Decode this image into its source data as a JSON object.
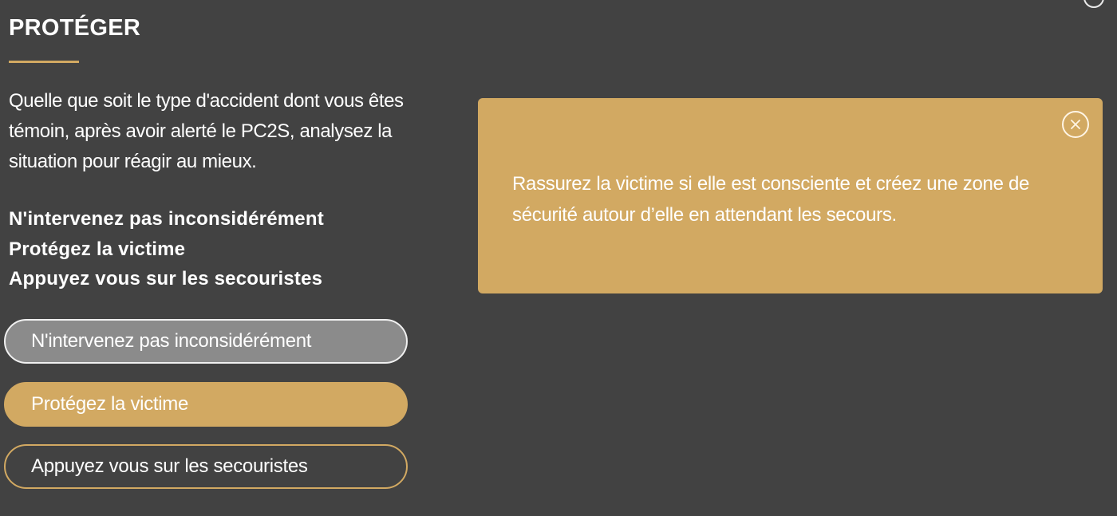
{
  "page": {
    "title": "PROTÉGER",
    "intro": "Quelle que soit le type d'accident dont vous êtes témoin, après avoir alerté le PC2S, analysez la situation pour réagir au mieux.",
    "key_points": [
      "N'intervenez pas inconsidérément",
      "Protégez la victime",
      "Appuyez vous sur les secouristes"
    ]
  },
  "choices": [
    {
      "label": "N'intervenez pas inconsidérément",
      "state": "visited"
    },
    {
      "label": "Protégez la victime",
      "state": "selected"
    },
    {
      "label": "Appuyez vous sur les secouristes",
      "state": "default"
    }
  ],
  "info_panel": {
    "text": "Rassurez la victime si elle est consciente et créez une zone de sécurité autour d’elle en attendant les secours.",
    "close_icon": "close-circle-icon"
  },
  "colors": {
    "background": "#424242",
    "accent": "#d2a962",
    "visited": "#8b8b8b",
    "text": "#ffffff"
  }
}
